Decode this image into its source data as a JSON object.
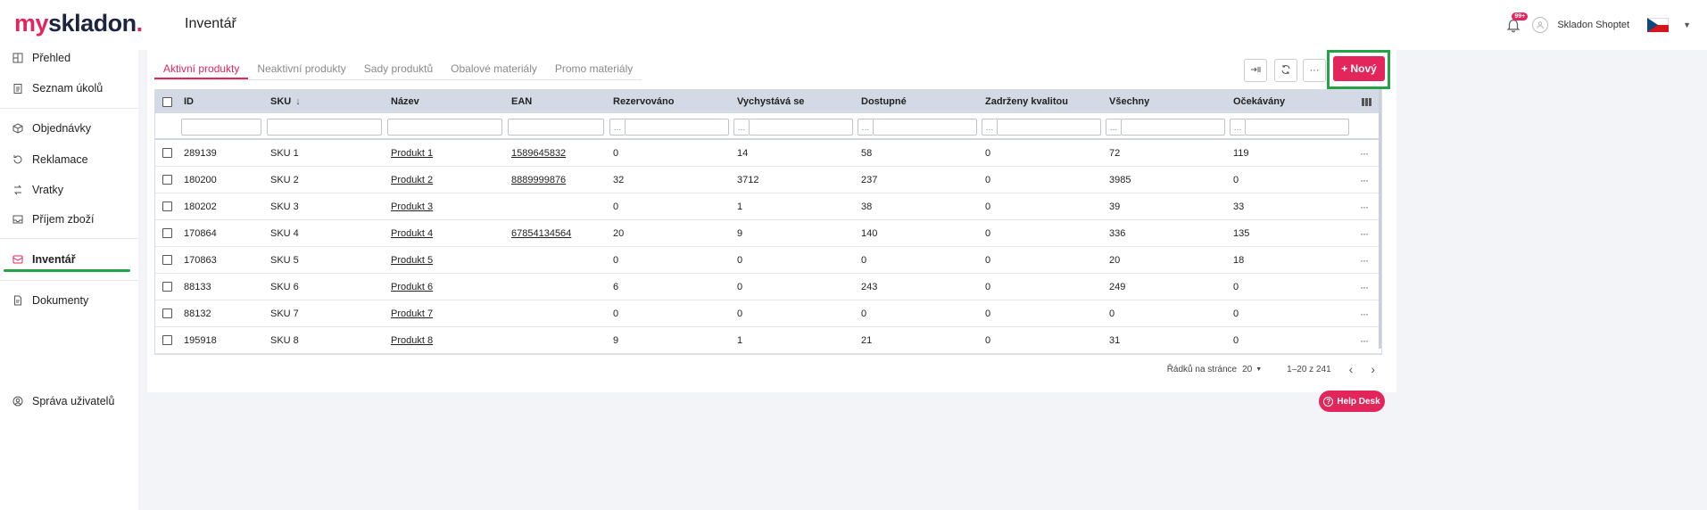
{
  "brand": {
    "logo_prefix": "my",
    "logo_main": "skladon",
    "logo_dot": ".",
    "accent": "#e2255b",
    "highlight": "#22a345"
  },
  "header": {
    "title": "Inventář",
    "notification_badge": "99+",
    "user_name": "Skladon Shoptet",
    "language_flag": "cz-flag-icon"
  },
  "sidebar": {
    "items": [
      {
        "label": "Přehled",
        "icon": "dashboard-icon"
      },
      {
        "label": "Seznam úkolů",
        "icon": "clipboard-icon"
      },
      {
        "label": "Objednávky",
        "icon": "box-icon"
      },
      {
        "label": "Reklamace",
        "icon": "return-icon"
      },
      {
        "label": "Vratky",
        "icon": "exchange-icon"
      },
      {
        "label": "Příjem zboží",
        "icon": "inbox-icon"
      },
      {
        "label": "Inventář",
        "icon": "inventory-icon",
        "active": true
      },
      {
        "label": "Dokumenty",
        "icon": "document-icon"
      },
      {
        "label": "Správa uživatelů",
        "icon": "users-icon"
      }
    ]
  },
  "tabs": [
    "Aktivní produkty",
    "Neaktivní produkty",
    "Sady produktů",
    "Obalové materiály",
    "Promo materiály"
  ],
  "toolbar": {
    "export_icon": "export-icon",
    "refresh_icon": "refresh-icon",
    "more_label": "···",
    "new_label": "+ Nový"
  },
  "table": {
    "columns": [
      "ID",
      "SKU",
      "Název",
      "EAN",
      "Rezervováno",
      "Vychystává se",
      "Dostupné",
      "Zadrženy kvalitou",
      "Všechny",
      "Očekávány"
    ],
    "filter_op": "…",
    "row_more": "···",
    "rows": [
      [
        "289139",
        "SKU 1",
        "Produkt 1",
        "1589645832",
        "0",
        "14",
        "58",
        "0",
        "72",
        "119"
      ],
      [
        "180200",
        "SKU 2",
        "Produkt 2",
        "8889999876",
        "32",
        "3712",
        "237",
        "0",
        "3985",
        "0"
      ],
      [
        "180202",
        "SKU 3",
        "Produkt 3",
        "",
        "0",
        "1",
        "38",
        "0",
        "39",
        "33"
      ],
      [
        "170864",
        "SKU 4",
        "Produkt 4",
        "67854134564",
        "20",
        "9",
        "140",
        "0",
        "336",
        "135"
      ],
      [
        "170863",
        "SKU 5",
        "Produkt 5",
        "",
        "0",
        "0",
        "0",
        "0",
        "20",
        "18"
      ],
      [
        "88133",
        "SKU 6",
        "Produkt 6",
        "",
        "6",
        "0",
        "243",
        "0",
        "249",
        "0"
      ],
      [
        "88132",
        "SKU 7",
        "Produkt 7",
        "",
        "0",
        "0",
        "0",
        "0",
        "0",
        "0"
      ],
      [
        "195918",
        "SKU 8",
        "Produkt 8",
        "",
        "9",
        "1",
        "21",
        "0",
        "31",
        "0"
      ]
    ]
  },
  "pagination": {
    "rows_per_page_label": "Řádků na stránce",
    "rows_per_page": "20",
    "range": "1–20 z 241",
    "prev": "‹",
    "next": "›"
  },
  "help": {
    "label": "Help Desk"
  }
}
